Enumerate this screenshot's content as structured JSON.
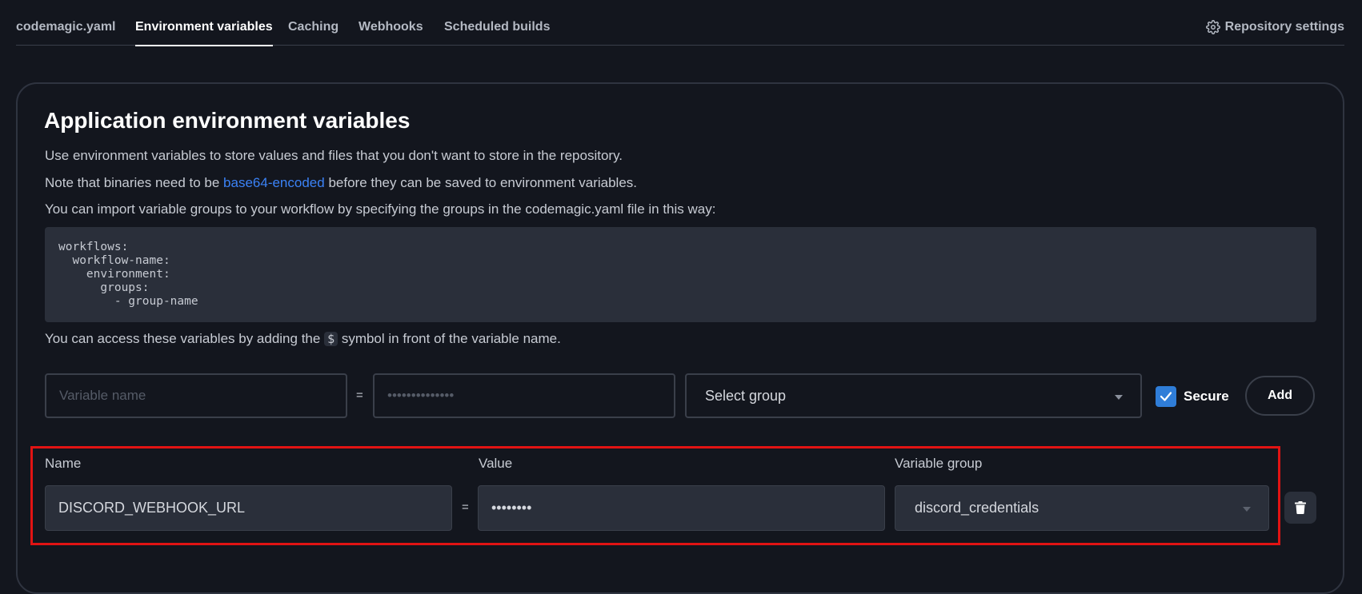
{
  "tabs": [
    {
      "label": "codemagic.yaml"
    },
    {
      "label": "Environment variables"
    },
    {
      "label": "Caching"
    },
    {
      "label": "Webhooks"
    },
    {
      "label": "Scheduled builds"
    }
  ],
  "repo_settings": {
    "label": "Repository settings",
    "icon": "gear-icon"
  },
  "section": {
    "title": "Application environment variables",
    "para1": "Use environment variables to store values and files that you don't want to store in the repository.",
    "para2_before": "Note that binaries need to be ",
    "para2_link": "base64-encoded",
    "para2_after": " before they can be saved to environment variables.",
    "para3": "You can import variable groups to your workflow by specifying the groups in the codemagic.yaml file in this way:",
    "code": "workflows:\n  workflow-name:\n    environment:\n      groups:\n        - group-name",
    "para4_before": "You can access these variables by adding the ",
    "para4_symbol": "$",
    "para4_after": " symbol in front of the variable name."
  },
  "form": {
    "name_placeholder": "Variable name",
    "equals": "=",
    "value_placeholder": "••••••••••••••",
    "group_select": "Select group",
    "secure_label": "Secure",
    "secure_checked": true,
    "add_label": "Add"
  },
  "table": {
    "headers": {
      "name": "Name",
      "value": "Value",
      "group": "Variable group"
    },
    "rows": [
      {
        "name": "DISCORD_WEBHOOK_URL",
        "equals": "=",
        "value": "••••••••",
        "group": "discord_credentials"
      }
    ]
  },
  "colors": {
    "accent": "#2f7dd8",
    "link": "#3b82f6",
    "highlight": "#e11313",
    "background": "#13161e"
  }
}
